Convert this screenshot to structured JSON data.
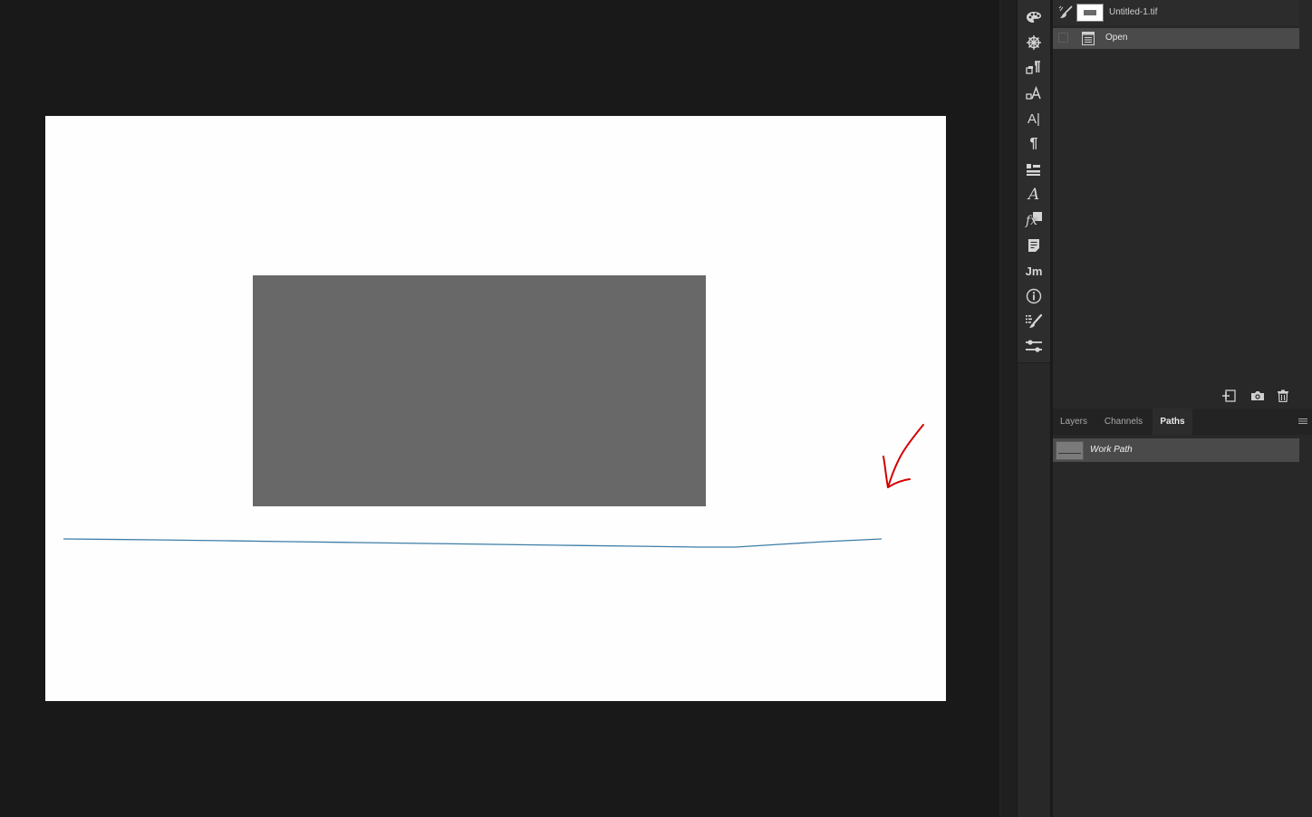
{
  "canvas": {
    "background": "#fefefe",
    "shape_color": "#686868",
    "path_stroke": "#3d7ea6",
    "annotation_arrow": "#d40000"
  },
  "icon_strip": {
    "icons": [
      "color-palette-icon",
      "navigator-icon",
      "character-styles-icon",
      "paragraph-styles-icon",
      "character-icon",
      "paragraph-icon",
      "3d-icon",
      "glyphs-icon",
      "styles-icon",
      "notes-icon",
      "measurement-log-icon",
      "info-icon",
      "brush-settings-icon",
      "properties-icon"
    ],
    "text_glyphs": {
      "character": "A|",
      "paragraph": "¶",
      "glyphs": "A",
      "styles": "fx",
      "measurement": "Jm"
    }
  },
  "history": {
    "document_name": "Untitled-1.tif",
    "items": [
      {
        "label": "Open"
      }
    ]
  },
  "paths_panel": {
    "tabs": [
      {
        "label": "Layers",
        "active": false
      },
      {
        "label": "Channels",
        "active": false
      },
      {
        "label": "Paths",
        "active": true
      }
    ],
    "paths": [
      {
        "label": "Work Path"
      }
    ]
  }
}
